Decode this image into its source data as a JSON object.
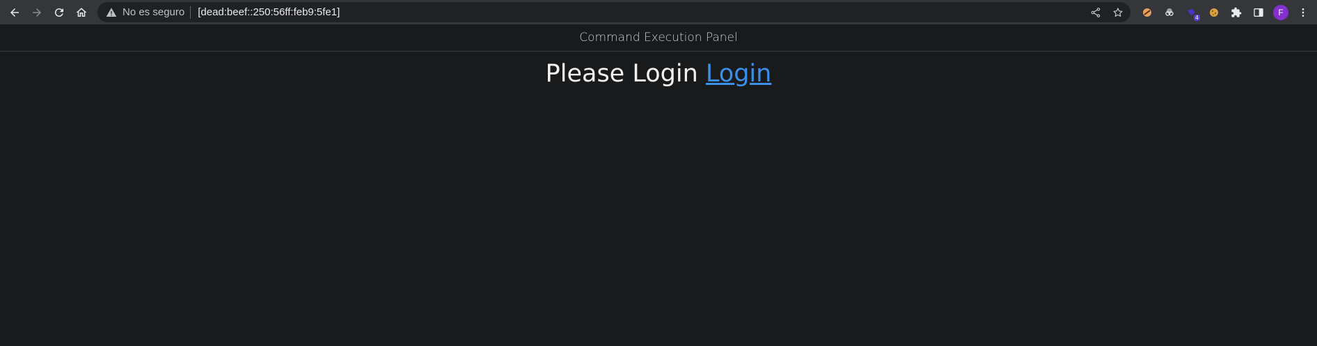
{
  "browser": {
    "security_label": "No es seguro",
    "url": "[dead:beef::250:56ff:feb9:5fe1]",
    "nav_icons": [
      "back-icon",
      "forward-icon",
      "reload-icon",
      "home-icon"
    ],
    "omnibox_icons": [
      "share-icon",
      "bookmark-star-icon"
    ],
    "extensions": [
      {
        "name": "extension-1-icon",
        "color": "#e8a060"
      },
      {
        "name": "extension-2-icon",
        "color": "#9aa0a6"
      },
      {
        "name": "extension-3-icon",
        "color": "#4a34c8",
        "badge": "4"
      },
      {
        "name": "cookie-icon",
        "color": "#d8a040"
      },
      {
        "name": "puzzle-icon",
        "color": "#e8eaed"
      },
      {
        "name": "side-panel-icon",
        "color": "#e8eaed"
      }
    ],
    "profile_initial": "F",
    "profile_color": "#8430ce"
  },
  "page": {
    "header_title": "Command Execution Panel",
    "message_text": "Please Login",
    "login_link": "Login",
    "link_color": "#3b8fe8",
    "background": "#191a1c"
  }
}
